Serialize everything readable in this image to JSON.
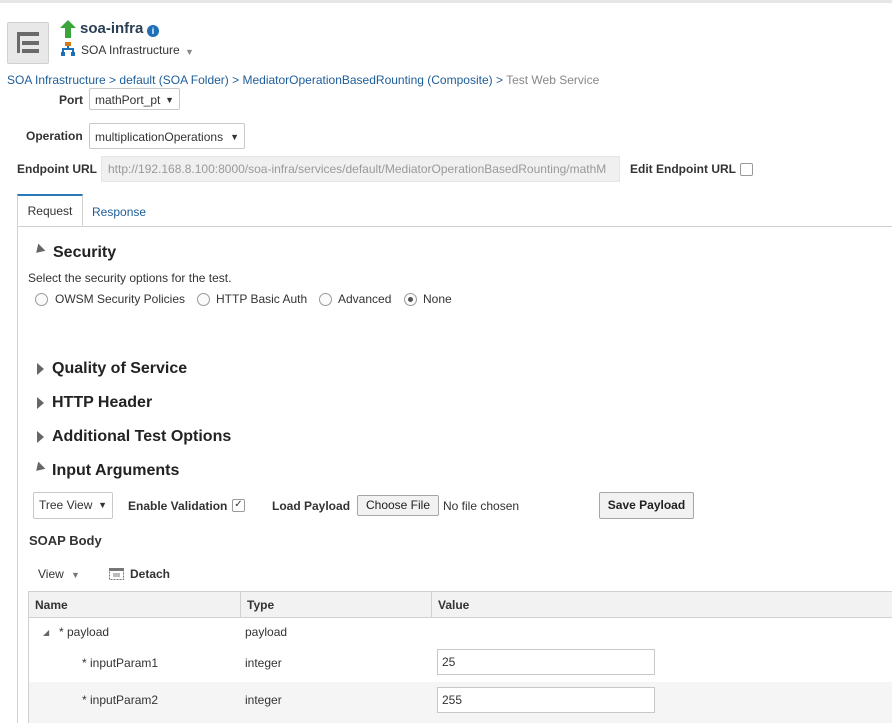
{
  "header": {
    "app_title": "soa-infra",
    "subtitle": "SOA Infrastructure"
  },
  "breadcrumb": {
    "items": [
      "SOA Infrastructure",
      "default (SOA Folder)",
      "MediatorOperationBasedRounting (Composite)"
    ],
    "separator": " > ",
    "current": "Test Web Service"
  },
  "form": {
    "port_label": "Port",
    "port_value": "mathPort_pt",
    "operation_label": "Operation",
    "operation_value": "multiplicationOperations",
    "endpoint_label": "Endpoint URL",
    "endpoint_value": "http://192.168.8.100:8000/soa-infra/services/default/MediatorOperationBasedRounting/mathM",
    "edit_endpoint_label": "Edit Endpoint URL",
    "edit_endpoint_checked": false
  },
  "tabs": {
    "request": "Request",
    "response": "Response",
    "active": "request"
  },
  "security": {
    "title": "Security",
    "description": "Select the security options for the test.",
    "options": [
      "OWSM Security Policies",
      "HTTP Basic Auth",
      "Advanced",
      "None"
    ],
    "selected": "None"
  },
  "sections": {
    "qos": "Quality of Service",
    "http_header": "HTTP Header",
    "additional": "Additional Test Options",
    "input_args": "Input Arguments"
  },
  "input_args": {
    "view_select": "Tree View",
    "enable_validation_label": "Enable Validation",
    "enable_validation_checked": true,
    "load_payload_label": "Load Payload",
    "choose_file_label": "Choose File",
    "no_file_text": "No file chosen",
    "save_payload_label": "Save Payload",
    "soap_body_label": "SOAP Body",
    "view_menu": "View",
    "detach_label": "Detach"
  },
  "table": {
    "columns": [
      "Name",
      "Type",
      "Value"
    ],
    "rows": [
      {
        "name": "* payload",
        "type": "payload",
        "value": ""
      },
      {
        "name": "* inputParam1",
        "type": "integer",
        "value": "25"
      },
      {
        "name": "* inputParam2",
        "type": "integer",
        "value": "255"
      }
    ]
  },
  "colors": {
    "link": "#1d5d99",
    "active_tab_accent": "#2a7ab9",
    "up_arrow": "#3aa53a"
  }
}
